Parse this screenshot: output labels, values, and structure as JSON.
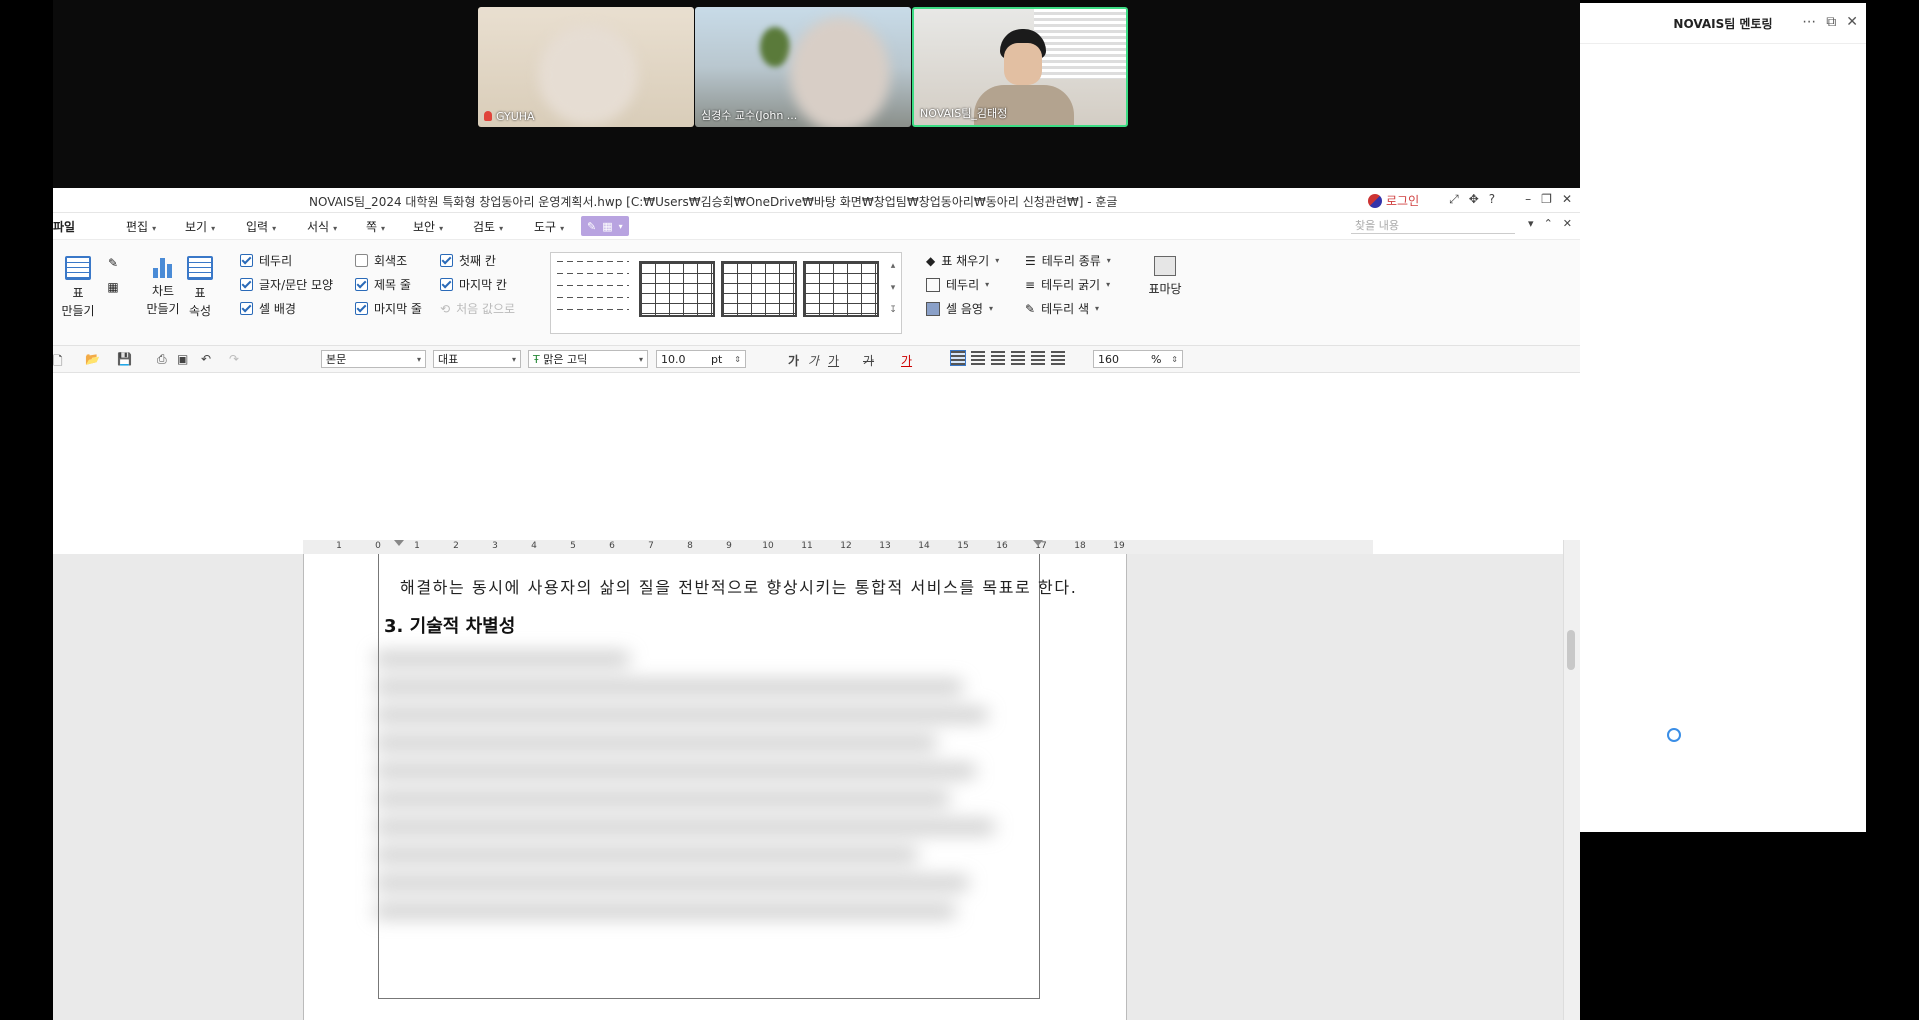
{
  "video": {
    "participants": [
      {
        "name": "GYUHA",
        "muted": true
      },
      {
        "name": "심경수 교수(John ...",
        "muted": false
      },
      {
        "name": "NOVAIS팀_김태정",
        "muted": false,
        "active_speaker": true
      }
    ],
    "active_border_color": "#3ddc84"
  },
  "chat_panel": {
    "title": "NOVAIS팀 멘토링",
    "actions": [
      "more-icon",
      "popout-icon",
      "close-icon"
    ]
  },
  "hwp": {
    "title": "NOVAIS팀_2024 대학원 특화형 창업동아리 운영계획서.hwp [C:₩Users₩김승회₩OneDrive₩바탕 화면₩창업팀₩창업동아리₩동아리 신청관련₩] - 훈글",
    "login_label": "로그인",
    "menus": [
      "파일",
      "편집",
      "보기",
      "입력",
      "서식",
      "쪽",
      "보안",
      "검토",
      "도구"
    ],
    "find_placeholder": "찾을 내용",
    "ribbon": {
      "table_make": "표\n만들기",
      "chart_make": "차트\n만들기",
      "table_props": "표\n속성",
      "checks_col1": [
        {
          "label": "테두리",
          "checked": true
        },
        {
          "label": "글자/문단 모양",
          "checked": true
        },
        {
          "label": "셀 배경",
          "checked": true
        }
      ],
      "checks_col2": [
        {
          "label": "회색조",
          "checked": false
        },
        {
          "label": "제목 줄",
          "checked": true
        },
        {
          "label": "마지막 줄",
          "checked": true
        }
      ],
      "checks_col3": [
        {
          "label": "첫째 칸",
          "checked": true
        },
        {
          "label": "마지막 칸",
          "checked": true
        }
      ],
      "reset_label": "처음 값으로",
      "right_col1": [
        "표 채우기",
        "테두리",
        "셀 음영"
      ],
      "right_col2": [
        "테두리 종류",
        "테두리 굵기",
        "테두리 색"
      ],
      "marker_label": "표마당"
    },
    "format": {
      "style": "본문",
      "lang": "대표",
      "font": "맑은 고딕",
      "size": "10.0",
      "size_unit": "pt",
      "zoom": "160",
      "zoom_unit": "%"
    },
    "ruler_ticks": [
      "1",
      "0",
      "1",
      "2",
      "3",
      "4",
      "5",
      "6",
      "7",
      "8",
      "9",
      "10",
      "11",
      "12",
      "13",
      "14",
      "15",
      "16",
      "17",
      "18",
      "19"
    ],
    "document": {
      "line1": "해결하는 동시에 사용자의 삶의 질을 전반적으로 향상시키는 통합적 서비스를 목표로 한다.",
      "heading": "3. 기술적 차별성"
    }
  }
}
